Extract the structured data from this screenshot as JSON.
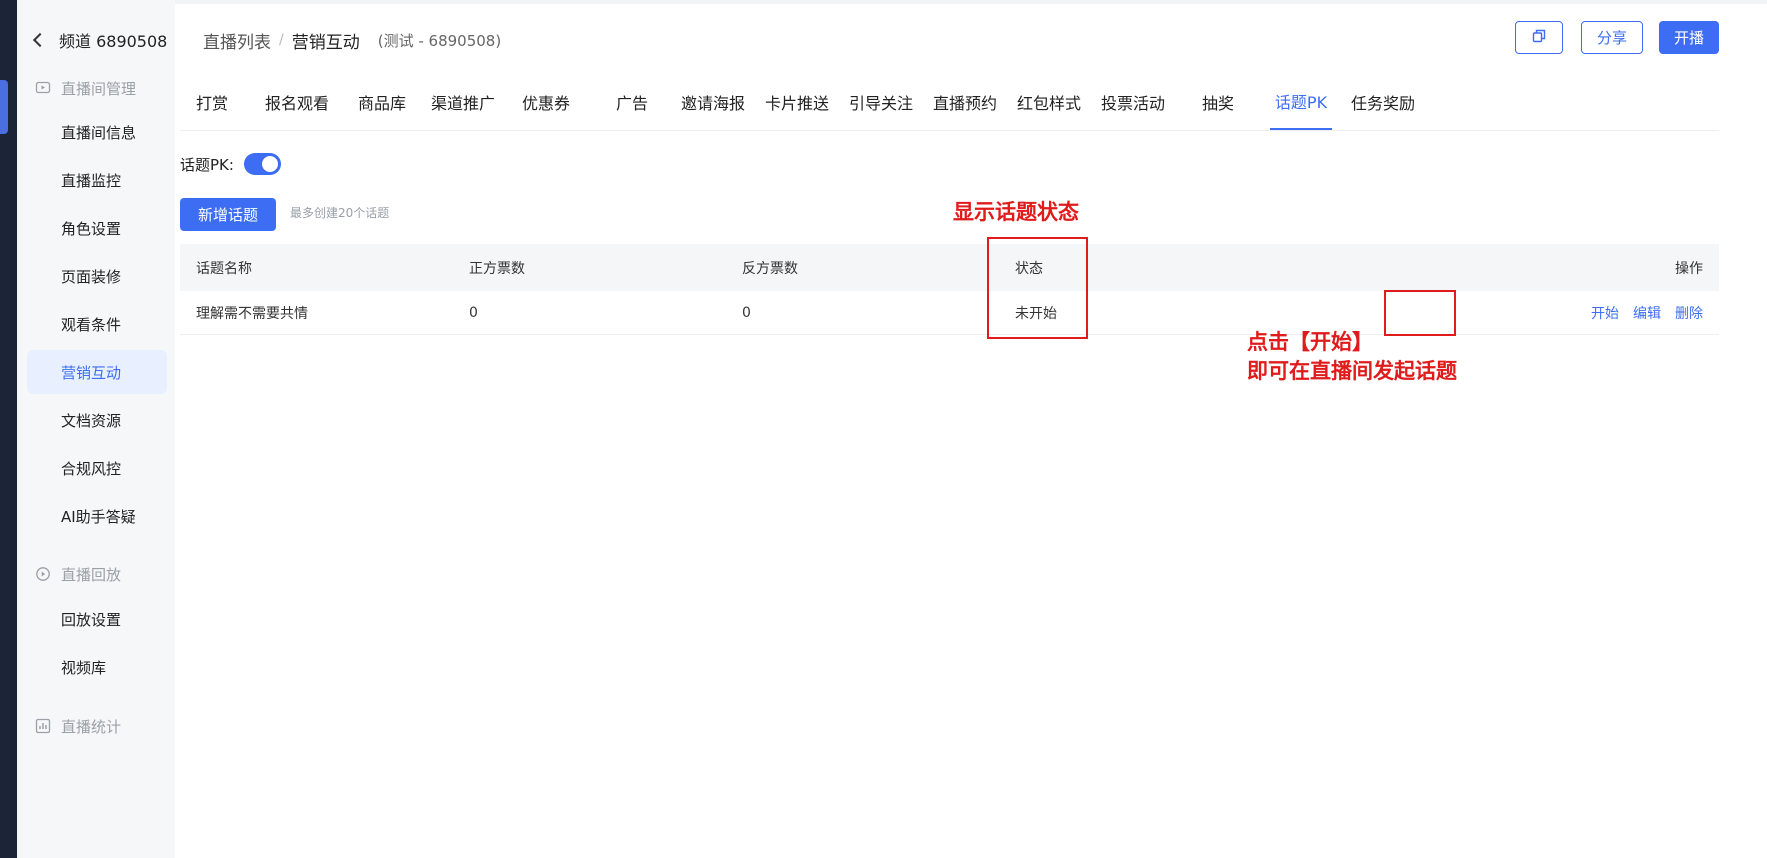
{
  "sidebar": {
    "back_label": "频道 6890508",
    "sections": [
      {
        "title": "直播间管理",
        "icon": "live-room-icon"
      },
      {
        "title": "直播回放",
        "icon": "replay-icon"
      },
      {
        "title": "直播统计",
        "icon": "stats-icon"
      }
    ],
    "items": [
      {
        "label": "直播间信息"
      },
      {
        "label": "直播监控"
      },
      {
        "label": "角色设置"
      },
      {
        "label": "页面装修"
      },
      {
        "label": "观看条件"
      },
      {
        "label": "营销互动",
        "active": true
      },
      {
        "label": "文档资源"
      },
      {
        "label": "合规风控"
      },
      {
        "label": "AI助手答疑"
      },
      {
        "label": "回放设置"
      },
      {
        "label": "视频库"
      }
    ]
  },
  "header": {
    "breadcrumb_root": "直播列表",
    "breadcrumb_sep": "/",
    "breadcrumb_current": "营销互动",
    "breadcrumb_sub": "(测试 - 6890508)",
    "copy_icon": "copy-icon",
    "share_label": "分享",
    "live_label": "开播"
  },
  "tabs": [
    {
      "label": "打赏"
    },
    {
      "label": "报名观看"
    },
    {
      "label": "商品库"
    },
    {
      "label": "渠道推广"
    },
    {
      "label": "优惠券"
    },
    {
      "label": "广告"
    },
    {
      "label": "邀请海报"
    },
    {
      "label": "卡片推送"
    },
    {
      "label": "引导关注"
    },
    {
      "label": "直播预约"
    },
    {
      "label": "红包样式"
    },
    {
      "label": "投票活动"
    },
    {
      "label": "抽奖"
    },
    {
      "label": "话题PK",
      "active": true
    },
    {
      "label": "任务奖励"
    }
  ],
  "topic_pk": {
    "toggle_label": "话题PK:",
    "toggle_on": true,
    "add_button": "新增话题",
    "add_hint": "最多创建20个话题"
  },
  "table": {
    "headers": {
      "name": "话题名称",
      "pro_votes": "正方票数",
      "con_votes": "反方票数",
      "status": "状态",
      "actions": "操作"
    },
    "rows": [
      {
        "name": "理解需不需要共情",
        "pro_votes": "0",
        "con_votes": "0",
        "status": "未开始",
        "actions": [
          "开始",
          "编辑",
          "删除"
        ]
      }
    ]
  },
  "annotations": {
    "status_note": "显示话题状态",
    "start_note_line1": "点击【开始】",
    "start_note_line2": "即可在直播间发起话题",
    "color": "#e01b1b"
  },
  "colors": {
    "accent": "#3d6df2",
    "sidebar_bg": "#f6f7f9",
    "left_bar": "#1c2438"
  }
}
